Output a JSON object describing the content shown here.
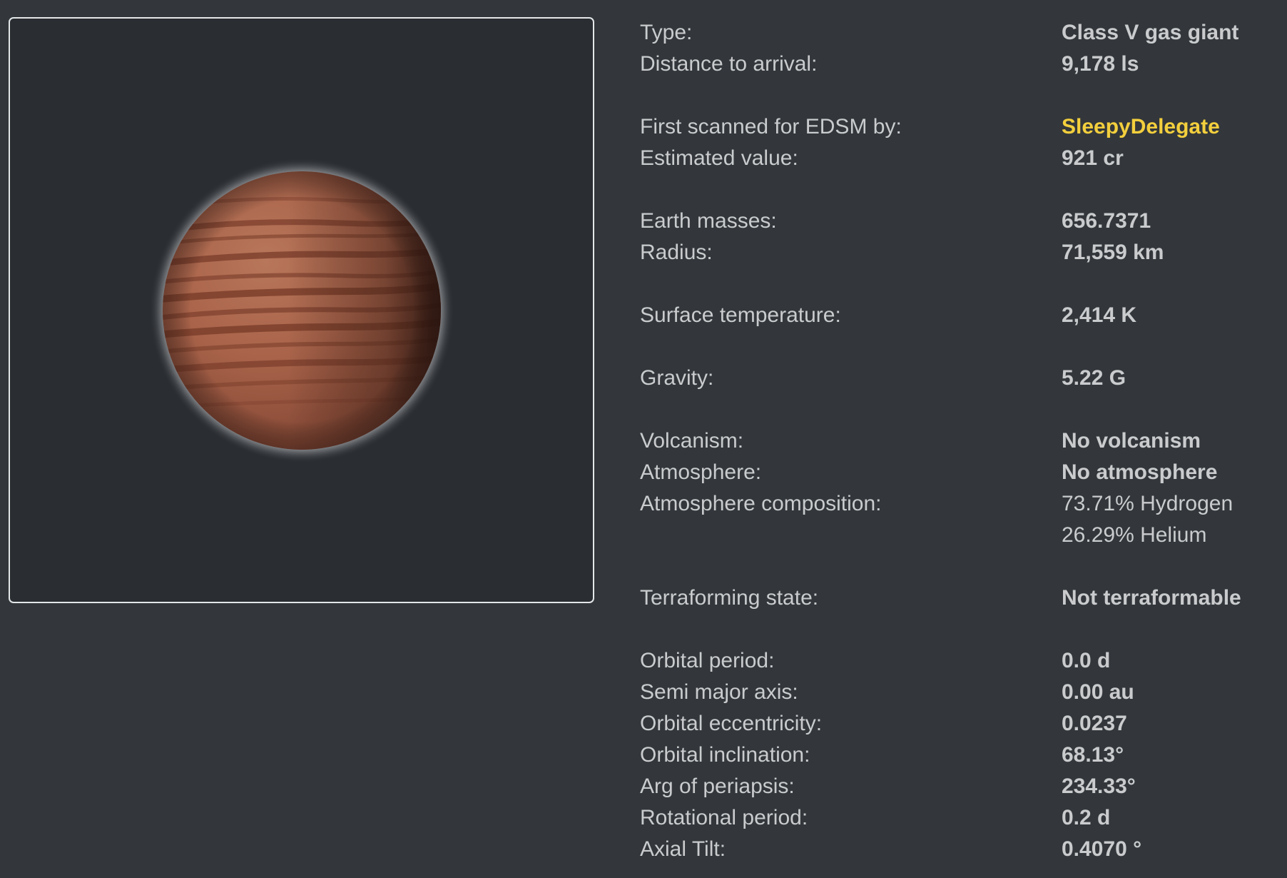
{
  "body": {
    "name": "Class V gas giant",
    "colors": {
      "background": "#33373b",
      "viewer_background": "#2a2d31",
      "link": "#f3cf3d",
      "planet": "#a9634a"
    }
  },
  "details": {
    "type": {
      "label": "Type:",
      "value": "Class V gas giant"
    },
    "distance": {
      "label": "Distance to arrival:",
      "value": "9,178 ls"
    },
    "first_scanned": {
      "label": "First scanned for EDSM by:",
      "value": "SleepyDelegate"
    },
    "estimated_value": {
      "label": "Estimated value:",
      "value": "921 cr"
    },
    "earth_masses": {
      "label": "Earth masses:",
      "value": "656.7371"
    },
    "radius": {
      "label": "Radius:",
      "value": "71,559 km"
    },
    "surface_temperature": {
      "label": "Surface temperature:",
      "value": "2,414 K"
    },
    "gravity": {
      "label": "Gravity:",
      "value": "5.22 G"
    },
    "volcanism": {
      "label": "Volcanism:",
      "value": "No volcanism"
    },
    "atmosphere": {
      "label": "Atmosphere:",
      "value": "No atmosphere"
    },
    "atmosphere_composition": {
      "label": "Atmosphere composition:",
      "values": [
        "73.71% Hydrogen",
        "26.29% Helium"
      ]
    },
    "terraforming": {
      "label": "Terraforming state:",
      "value": "Not terraformable"
    },
    "orbital_period": {
      "label": "Orbital period:",
      "value": "0.0 d"
    },
    "semi_major_axis": {
      "label": "Semi major axis:",
      "value": "0.00 au"
    },
    "orbital_eccentricity": {
      "label": "Orbital eccentricity:",
      "value": "0.0237"
    },
    "orbital_inclination": {
      "label": "Orbital inclination:",
      "value": "68.13°"
    },
    "arg_of_periapsis": {
      "label": "Arg of periapsis:",
      "value": "234.33°"
    },
    "rotational_period": {
      "label": "Rotational period:",
      "value": "0.2 d"
    },
    "axial_tilt": {
      "label": "Axial Tilt:",
      "value": "0.4070 °"
    }
  }
}
